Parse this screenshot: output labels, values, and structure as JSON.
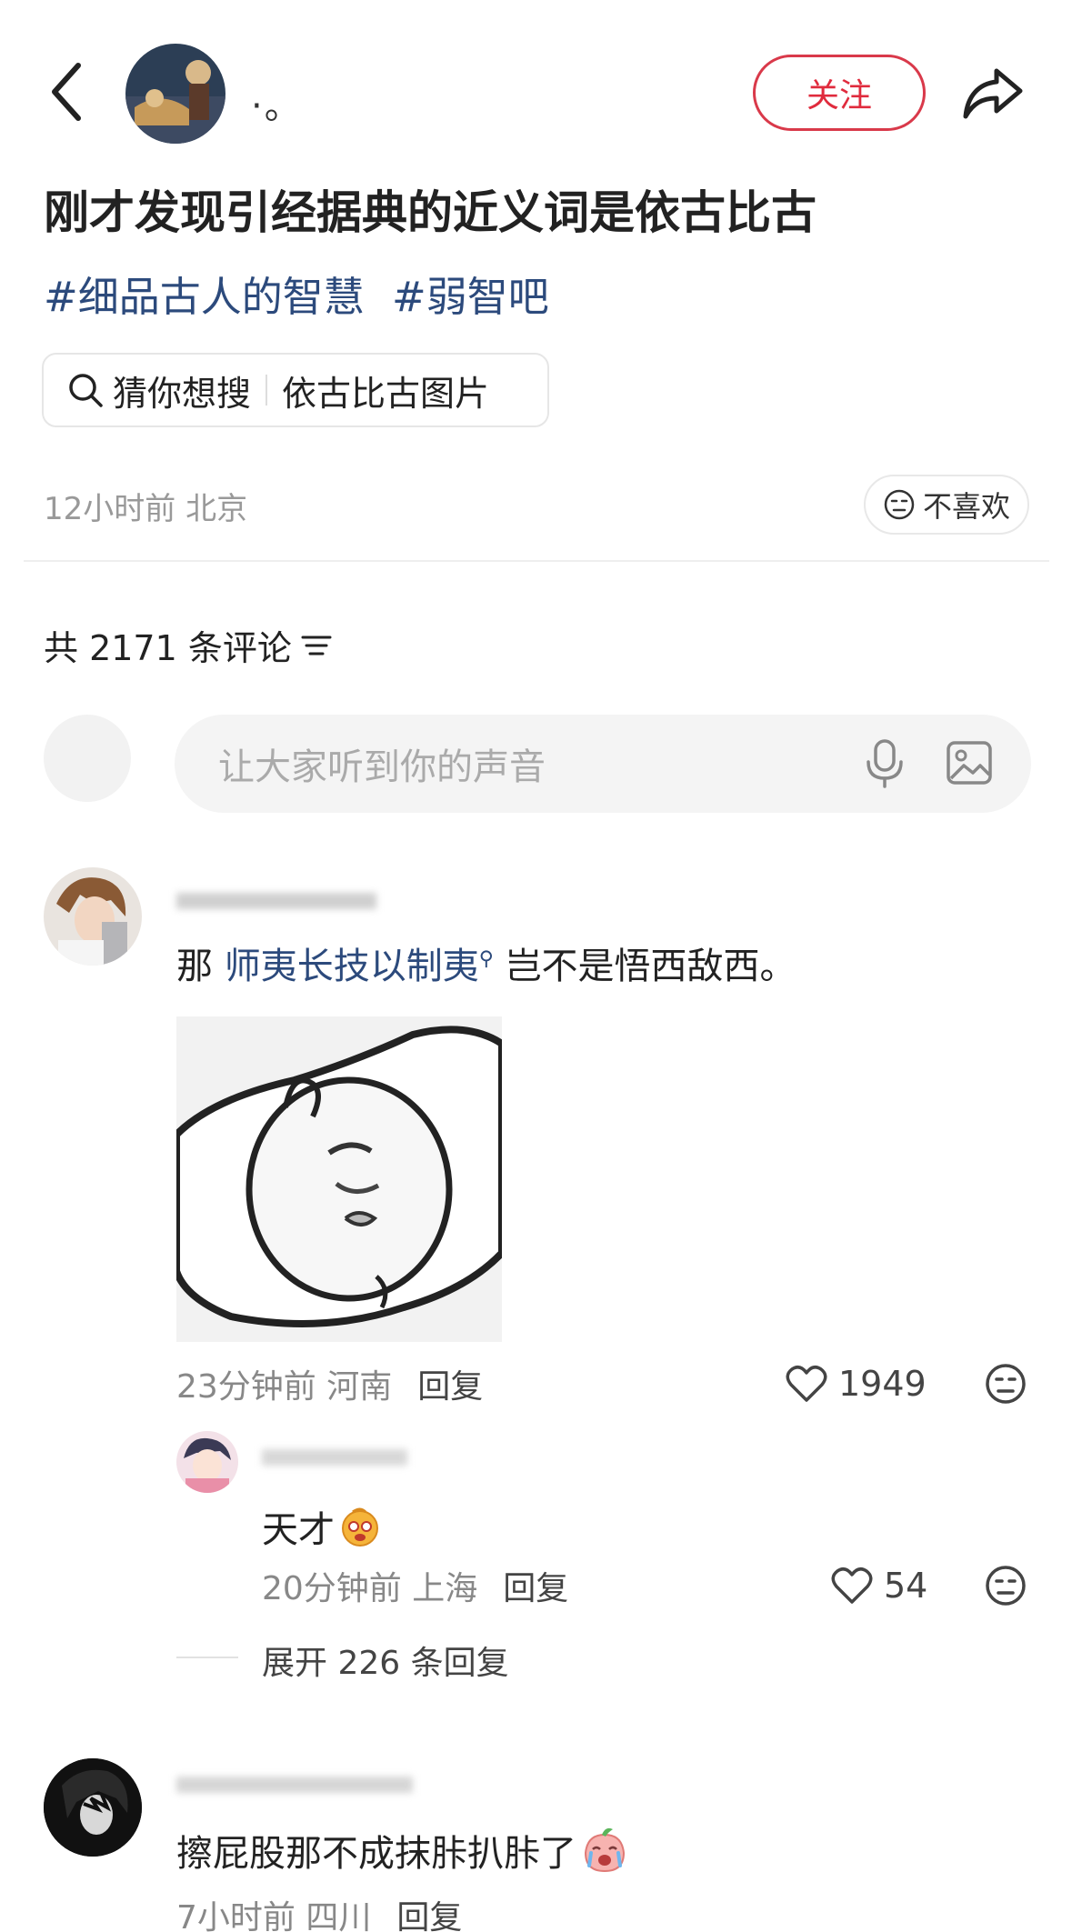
{
  "header": {
    "author_name": "·。",
    "follow_label": "关注"
  },
  "post": {
    "title": "刚才发现引经据典的近义词是依古比古",
    "tags": [
      "#细品古人的智慧",
      "#弱智吧"
    ],
    "search_chip": {
      "prefix": "猜你想搜",
      "query": "依古比古图片"
    },
    "time_location": "12小时前 北京",
    "dislike_label": "不喜欢"
  },
  "comments_section": {
    "count_label": "共 2171 条评论",
    "input_placeholder": "让大家听到你的声音"
  },
  "comments": [
    {
      "text_before": "那 ",
      "link_text": "师夷长技以制夷",
      "text_after": " 岂不是悟西敌西。",
      "time_location": "23分钟前 河南",
      "reply_label": "回复",
      "likes": "1949",
      "replies": [
        {
          "text": "天才",
          "time_location": "20分钟前 上海",
          "reply_label": "回复",
          "likes": "54"
        }
      ],
      "expand_label": "展开 226 条回复"
    },
    {
      "text": "擦屁股那不成抹胩扒胩了",
      "time_location": "7小时前 四川",
      "reply_label": "回复"
    }
  ]
}
